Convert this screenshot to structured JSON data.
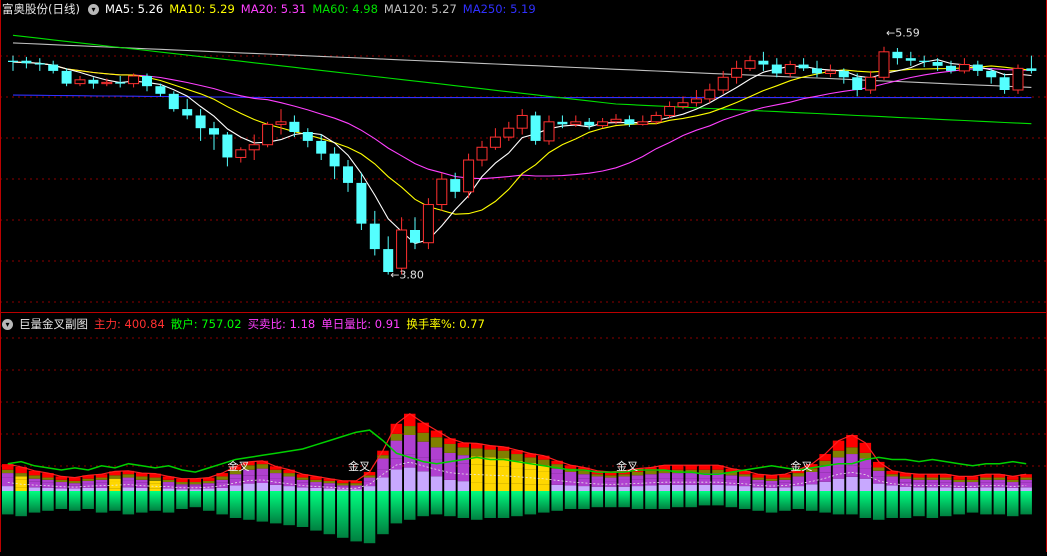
{
  "header": {
    "stock_name": "富奥股份(日线)",
    "ma": [
      {
        "label": "MA5: 5.26",
        "color": "#ffffff"
      },
      {
        "label": "MA10: 5.29",
        "color": "#ffff00"
      },
      {
        "label": "MA20: 5.31",
        "color": "#ff40ff"
      },
      {
        "label": "MA60: 4.98",
        "color": "#00e000"
      },
      {
        "label": "MA120: 5.27",
        "color": "#c0c0c0"
      },
      {
        "label": "MA250: 5.19",
        "color": "#3030ff"
      }
    ]
  },
  "sub_header": {
    "indicator_name": "巨量金叉副图",
    "items": [
      {
        "label": "主力: 400.84",
        "color": "#ff3030"
      },
      {
        "label": "散户: 757.02",
        "color": "#00ff00"
      },
      {
        "label": "买卖比: 1.18",
        "color": "#ff40ff"
      },
      {
        "label": "单日量比: 0.91",
        "color": "#ff40ff"
      },
      {
        "label": "换手率%: 0.77",
        "color": "#ffff00"
      }
    ]
  },
  "colors": {
    "up": "#ff3030",
    "down": "#54ffff",
    "grid": "#8b0000",
    "frame": "#b00000",
    "ma5": "#ffffff",
    "ma10": "#ffff00",
    "ma20": "#ff40ff",
    "ma60": "#00e000",
    "ma120": "#c0c0c0",
    "ma250": "#3030ff",
    "sub_top": "#ff0000",
    "sub_olive": "#808000",
    "sub_yellow": "#ffd700",
    "sub_purple": "#b040d0",
    "sub_lavender": "#c8a8ff",
    "sub_green_line": "#00d000",
    "sub_red_line": "#ff2020",
    "sub_neg_top": "#00ff80",
    "sub_neg_bottom": "#008040"
  },
  "chart_data": [
    {
      "type": "candlestick",
      "title": "富奥股份(日线)",
      "ylim": [
        3.6,
        5.8
      ],
      "annotations": [
        {
          "text": "5.59",
          "price": 5.59
        },
        {
          "text": "3.80",
          "price": 3.8
        }
      ],
      "candles": [
        [
          5.48,
          5.47,
          5.52,
          5.4
        ],
        [
          5.48,
          5.46,
          5.51,
          5.42
        ],
        [
          5.46,
          5.45,
          5.5,
          5.4
        ],
        [
          5.45,
          5.4,
          5.48,
          5.38
        ],
        [
          5.4,
          5.3,
          5.42,
          5.28
        ],
        [
          5.3,
          5.33,
          5.36,
          5.28
        ],
        [
          5.33,
          5.3,
          5.35,
          5.26
        ],
        [
          5.3,
          5.31,
          5.34,
          5.28
        ],
        [
          5.31,
          5.3,
          5.36,
          5.27
        ],
        [
          5.3,
          5.36,
          5.38,
          5.27
        ],
        [
          5.36,
          5.28,
          5.38,
          5.24
        ],
        [
          5.28,
          5.22,
          5.3,
          5.2
        ],
        [
          5.22,
          5.1,
          5.24,
          5.08
        ],
        [
          5.1,
          5.05,
          5.18,
          5.02
        ],
        [
          5.05,
          4.95,
          5.1,
          4.85
        ],
        [
          4.95,
          4.9,
          5.0,
          4.78
        ],
        [
          4.9,
          4.72,
          4.92,
          4.65
        ],
        [
          4.72,
          4.78,
          4.8,
          4.68
        ],
        [
          4.78,
          4.82,
          4.9,
          4.7
        ],
        [
          4.82,
          4.98,
          5.0,
          4.8
        ],
        [
          4.98,
          5.0,
          5.1,
          4.9
        ],
        [
          5.0,
          4.92,
          5.05,
          4.88
        ],
        [
          4.92,
          4.85,
          4.95,
          4.8
        ],
        [
          4.85,
          4.75,
          4.9,
          4.7
        ],
        [
          4.75,
          4.65,
          4.8,
          4.55
        ],
        [
          4.65,
          4.52,
          4.7,
          4.45
        ],
        [
          4.52,
          4.2,
          4.6,
          4.15
        ],
        [
          4.2,
          4.0,
          4.3,
          3.95
        ],
        [
          4.0,
          3.82,
          4.1,
          3.8
        ],
        [
          3.85,
          4.15,
          4.25,
          3.8
        ],
        [
          4.15,
          4.05,
          4.25,
          4.0
        ],
        [
          4.05,
          4.35,
          4.4,
          4.0
        ],
        [
          4.35,
          4.55,
          4.6,
          4.3
        ],
        [
          4.55,
          4.45,
          4.6,
          4.4
        ],
        [
          4.45,
          4.7,
          4.75,
          4.4
        ],
        [
          4.7,
          4.8,
          4.85,
          4.65
        ],
        [
          4.8,
          4.88,
          4.95,
          4.78
        ],
        [
          4.88,
          4.95,
          5.0,
          4.85
        ],
        [
          4.95,
          5.05,
          5.1,
          4.9
        ],
        [
          5.05,
          4.85,
          5.08,
          4.82
        ],
        [
          4.85,
          5.0,
          5.05,
          4.82
        ],
        [
          5.0,
          4.98,
          5.05,
          4.95
        ],
        [
          4.98,
          5.0,
          5.05,
          4.96
        ],
        [
          5.0,
          4.97,
          5.03,
          4.94
        ],
        [
          4.97,
          5.0,
          5.03,
          4.95
        ],
        [
          5.0,
          5.02,
          5.06,
          4.98
        ],
        [
          5.02,
          4.98,
          5.05,
          4.96
        ],
        [
          4.98,
          5.0,
          5.05,
          4.97
        ],
        [
          5.0,
          5.05,
          5.08,
          4.98
        ],
        [
          5.05,
          5.12,
          5.16,
          5.03
        ],
        [
          5.12,
          5.15,
          5.2,
          5.1
        ],
        [
          5.15,
          5.18,
          5.25,
          5.12
        ],
        [
          5.18,
          5.25,
          5.3,
          5.15
        ],
        [
          5.25,
          5.35,
          5.4,
          5.22
        ],
        [
          5.35,
          5.42,
          5.48,
          5.3
        ],
        [
          5.42,
          5.48,
          5.52,
          5.4
        ],
        [
          5.48,
          5.45,
          5.55,
          5.4
        ],
        [
          5.45,
          5.38,
          5.5,
          5.35
        ],
        [
          5.38,
          5.45,
          5.48,
          5.35
        ],
        [
          5.45,
          5.42,
          5.5,
          5.4
        ],
        [
          5.42,
          5.38,
          5.48,
          5.35
        ],
        [
          5.38,
          5.4,
          5.45,
          5.35
        ],
        [
          5.4,
          5.35,
          5.42,
          5.3
        ],
        [
          5.35,
          5.25,
          5.38,
          5.2
        ],
        [
          5.25,
          5.35,
          5.4,
          5.22
        ],
        [
          5.35,
          5.55,
          5.59,
          5.33
        ],
        [
          5.55,
          5.5,
          5.58,
          5.45
        ],
        [
          5.5,
          5.48,
          5.55,
          5.44
        ],
        [
          5.48,
          5.47,
          5.52,
          5.43
        ],
        [
          5.47,
          5.44,
          5.5,
          5.4
        ],
        [
          5.44,
          5.4,
          5.48,
          5.38
        ],
        [
          5.4,
          5.45,
          5.5,
          5.38
        ],
        [
          5.45,
          5.4,
          5.48,
          5.36
        ],
        [
          5.4,
          5.35,
          5.42,
          5.3
        ],
        [
          5.35,
          5.25,
          5.38,
          5.22
        ],
        [
          5.25,
          5.42,
          5.45,
          5.22
        ],
        [
          5.42,
          5.4,
          5.52,
          5.38
        ]
      ]
    },
    {
      "type": "stacked_bar",
      "title": "巨量金叉副图",
      "annotations": [
        {
          "text": "金叉",
          "bar": 26
        },
        {
          "text": "金叉",
          "bar": 17
        },
        {
          "text": "金叉",
          "bar": 46
        },
        {
          "text": "金叉",
          "bar": 59
        }
      ],
      "bars": [
        [
          0.8,
          0.4,
          0.8,
          0.3,
          0.5,
          1.3
        ],
        [
          0.6,
          0.4,
          0.7,
          0.3,
          0.4,
          1.4
        ],
        [
          0.6,
          0.3,
          0.5,
          0.3,
          0.3,
          1.2
        ],
        [
          0.5,
          0.3,
          0.5,
          0.2,
          0.3,
          1.1
        ],
        [
          0.4,
          0.2,
          0.4,
          0.2,
          0.2,
          1.0
        ],
        [
          0.4,
          0.2,
          0.3,
          0.2,
          0.2,
          1.1
        ],
        [
          0.5,
          0.2,
          0.4,
          0.2,
          0.2,
          1.0
        ],
        [
          0.5,
          0.2,
          0.5,
          0.2,
          0.3,
          1.2
        ],
        [
          0.5,
          0.2,
          0.6,
          0.3,
          0.3,
          1.1
        ],
        [
          0.6,
          0.2,
          0.6,
          0.3,
          0.4,
          1.3
        ],
        [
          0.5,
          0.2,
          0.5,
          0.3,
          0.4,
          1.2
        ],
        [
          0.4,
          0.2,
          0.5,
          0.3,
          0.3,
          1.1
        ],
        [
          0.4,
          0.2,
          0.4,
          0.2,
          0.3,
          1.2
        ],
        [
          0.3,
          0.2,
          0.3,
          0.2,
          0.2,
          1.0
        ],
        [
          0.3,
          0.2,
          0.3,
          0.2,
          0.2,
          0.9
        ],
        [
          0.4,
          0.2,
          0.3,
          0.2,
          0.3,
          1.1
        ],
        [
          0.5,
          0.2,
          0.5,
          0.3,
          0.4,
          1.3
        ],
        [
          0.9,
          0.2,
          0.6,
          0.4,
          0.6,
          1.5
        ],
        [
          1.2,
          0.2,
          0.7,
          0.4,
          0.7,
          1.6
        ],
        [
          1.3,
          0.2,
          0.7,
          0.4,
          0.8,
          1.7
        ],
        [
          1.0,
          0.2,
          0.6,
          0.3,
          0.6,
          1.8
        ],
        [
          0.8,
          0.2,
          0.5,
          0.3,
          0.5,
          1.9
        ],
        [
          0.6,
          0.2,
          0.4,
          0.2,
          0.4,
          2.0
        ],
        [
          0.5,
          0.2,
          0.3,
          0.2,
          0.3,
          2.2
        ],
        [
          0.4,
          0.1,
          0.3,
          0.2,
          0.3,
          2.4
        ],
        [
          0.3,
          0.1,
          0.2,
          0.2,
          0.2,
          2.6
        ],
        [
          0.3,
          0.1,
          0.2,
          0.2,
          0.2,
          2.8
        ],
        [
          0.8,
          0.2,
          0.4,
          0.2,
          0.4,
          2.9
        ],
        [
          2.2,
          0.3,
          0.7,
          0.3,
          0.7,
          2.4
        ],
        [
          3.5,
          0.8,
          1.0,
          0.6,
          1.4,
          1.8
        ],
        [
          3.8,
          1.0,
          1.2,
          0.8,
          1.5,
          1.6
        ],
        [
          3.2,
          0.8,
          1.2,
          0.8,
          1.7,
          1.4
        ],
        [
          2.4,
          0.5,
          1.5,
          0.9,
          1.8,
          1.3
        ],
        [
          1.8,
          0.4,
          1.6,
          0.8,
          1.8,
          1.4
        ],
        [
          1.6,
          0.3,
          1.6,
          0.7,
          1.8,
          1.5
        ],
        [
          1.5,
          0.3,
          1.6,
          0.7,
          1.7,
          1.6
        ],
        [
          1.4,
          0.2,
          1.6,
          0.7,
          1.7,
          1.5
        ],
        [
          1.4,
          0.2,
          1.5,
          0.7,
          1.6,
          1.5
        ],
        [
          1.3,
          0.2,
          1.4,
          0.6,
          1.5,
          1.4
        ],
        [
          1.2,
          0.2,
          1.3,
          0.5,
          1.4,
          1.3
        ],
        [
          1.1,
          0.2,
          1.2,
          0.5,
          1.3,
          1.2
        ],
        [
          1.0,
          0.2,
          1.0,
          0.4,
          1.2,
          1.1
        ],
        [
          0.9,
          0.2,
          0.8,
          0.3,
          1.1,
          1.0
        ],
        [
          0.8,
          0.2,
          0.7,
          0.3,
          1.0,
          1.0
        ],
        [
          0.7,
          0.2,
          0.6,
          0.2,
          0.9,
          0.9
        ],
        [
          0.7,
          0.2,
          0.5,
          0.2,
          0.8,
          0.9
        ],
        [
          0.7,
          0.2,
          0.6,
          0.2,
          0.8,
          0.9
        ],
        [
          0.8,
          0.2,
          0.6,
          0.3,
          0.8,
          1.0
        ],
        [
          0.9,
          0.2,
          0.6,
          0.3,
          0.8,
          1.0
        ],
        [
          1.0,
          0.3,
          0.6,
          0.3,
          0.8,
          1.0
        ],
        [
          1.0,
          0.3,
          0.6,
          0.3,
          0.8,
          0.9
        ],
        [
          1.0,
          0.3,
          0.6,
          0.3,
          0.8,
          0.9
        ],
        [
          1.0,
          0.3,
          0.6,
          0.3,
          0.8,
          0.8
        ],
        [
          1.0,
          0.3,
          0.6,
          0.3,
          0.8,
          0.8
        ],
        [
          0.9,
          0.2,
          0.5,
          0.3,
          0.7,
          0.9
        ],
        [
          0.8,
          0.2,
          0.5,
          0.2,
          0.7,
          1.0
        ],
        [
          0.6,
          0.2,
          0.4,
          0.2,
          0.6,
          1.1
        ],
        [
          0.5,
          0.2,
          0.4,
          0.2,
          0.5,
          1.2
        ],
        [
          0.6,
          0.2,
          0.4,
          0.2,
          0.6,
          1.1
        ],
        [
          0.8,
          0.2,
          0.5,
          0.3,
          0.7,
          1.0
        ],
        [
          1.1,
          0.3,
          0.6,
          0.3,
          0.8,
          1.1
        ],
        [
          1.5,
          0.5,
          0.8,
          0.4,
          1.0,
          1.2
        ],
        [
          2.0,
          0.8,
          1.0,
          0.6,
          1.2,
          1.3
        ],
        [
          2.3,
          1.0,
          1.0,
          0.6,
          1.3,
          1.3
        ],
        [
          2.0,
          0.8,
          0.9,
          0.5,
          1.2,
          1.5
        ],
        [
          1.2,
          0.4,
          0.6,
          0.3,
          1.0,
          1.6
        ],
        [
          0.9,
          0.2,
          0.4,
          0.2,
          0.8,
          1.5
        ],
        [
          0.7,
          0.2,
          0.4,
          0.2,
          0.7,
          1.5
        ],
        [
          0.6,
          0.2,
          0.4,
          0.2,
          0.6,
          1.4
        ],
        [
          0.6,
          0.2,
          0.4,
          0.2,
          0.7,
          1.5
        ],
        [
          0.6,
          0.2,
          0.4,
          0.2,
          0.6,
          1.4
        ],
        [
          0.5,
          0.2,
          0.3,
          0.2,
          0.6,
          1.3
        ],
        [
          0.5,
          0.2,
          0.3,
          0.2,
          0.5,
          1.2
        ],
        [
          0.6,
          0.2,
          0.4,
          0.2,
          0.5,
          1.3
        ],
        [
          0.6,
          0.2,
          0.4,
          0.2,
          0.6,
          1.3
        ],
        [
          0.5,
          0.2,
          0.3,
          0.2,
          0.5,
          1.4
        ],
        [
          0.6,
          0.2,
          0.4,
          0.2,
          0.5,
          1.3
        ]
      ]
    }
  ]
}
